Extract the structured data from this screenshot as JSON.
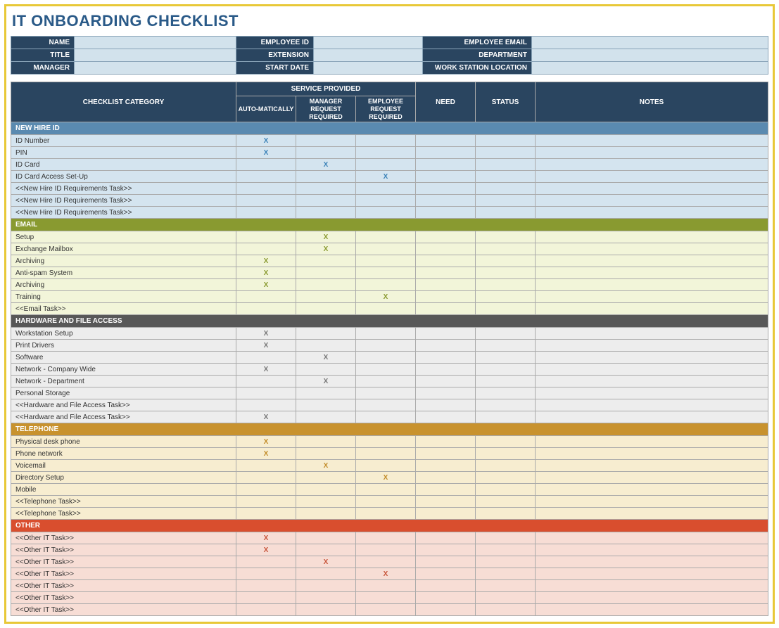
{
  "title": "IT ONBOARDING CHECKLIST",
  "info": {
    "name_label": "NAME",
    "name": "",
    "empid_label": "EMPLOYEE ID",
    "empid": "",
    "email_label": "EMPLOYEE EMAIL",
    "email": "",
    "title_label": "TITLE",
    "title_v": "",
    "ext_label": "EXTENSION",
    "ext": "",
    "dept_label": "DEPARTMENT",
    "dept": "",
    "mgr_label": "MANAGER",
    "mgr": "",
    "start_label": "START DATE",
    "start": "",
    "loc_label": "WORK STATION LOCATION",
    "loc": ""
  },
  "headers": {
    "category": "CHECKLIST CATEGORY",
    "service": "SERVICE PROVIDED",
    "auto": "AUTO-MATICALLY",
    "mgr_req": "MANAGER REQUEST REQUIRED",
    "emp_req": "EMPLOYEE REQUEST REQUIRED",
    "need": "NEED",
    "status": "STATUS",
    "notes": "NOTES"
  },
  "sections": [
    {
      "name": "NEW HIRE ID",
      "class": "newhire",
      "rows": [
        {
          "label": "ID Number",
          "auto": "X",
          "mgr": "",
          "emp": ""
        },
        {
          "label": "PIN",
          "auto": "X",
          "mgr": "",
          "emp": ""
        },
        {
          "label": "ID Card",
          "auto": "",
          "mgr": "X",
          "emp": ""
        },
        {
          "label": "ID Card Access Set-Up",
          "auto": "",
          "mgr": "",
          "emp": "X"
        },
        {
          "label": "<<New Hire ID Requirements Task>>",
          "auto": "",
          "mgr": "",
          "emp": ""
        },
        {
          "label": "<<New Hire ID Requirements Task>>",
          "auto": "",
          "mgr": "",
          "emp": ""
        },
        {
          "label": "<<New Hire ID Requirements Task>>",
          "auto": "",
          "mgr": "",
          "emp": ""
        }
      ]
    },
    {
      "name": "EMAIL",
      "class": "email",
      "rows": [
        {
          "label": "Setup",
          "auto": "",
          "mgr": "X",
          "emp": ""
        },
        {
          "label": "Exchange Mailbox",
          "auto": "",
          "mgr": "X",
          "emp": ""
        },
        {
          "label": "Archiving",
          "auto": "X",
          "mgr": "",
          "emp": ""
        },
        {
          "label": "Anti-spam System",
          "auto": "X",
          "mgr": "",
          "emp": ""
        },
        {
          "label": "Archiving",
          "auto": "X",
          "mgr": "",
          "emp": ""
        },
        {
          "label": "Training",
          "auto": "",
          "mgr": "",
          "emp": "X"
        },
        {
          "label": "<<Email Task>>",
          "auto": "",
          "mgr": "",
          "emp": ""
        }
      ]
    },
    {
      "name": "HARDWARE AND FILE ACCESS",
      "class": "hardware",
      "rows": [
        {
          "label": "Workstation Setup",
          "auto": "X",
          "mgr": "",
          "emp": ""
        },
        {
          "label": "Print Drivers",
          "auto": "X",
          "mgr": "",
          "emp": ""
        },
        {
          "label": "Software",
          "auto": "",
          "mgr": "X",
          "emp": ""
        },
        {
          "label": "Network - Company Wide",
          "auto": "X",
          "mgr": "",
          "emp": ""
        },
        {
          "label": "Network - Department",
          "auto": "",
          "mgr": "X",
          "emp": ""
        },
        {
          "label": "Personal Storage",
          "auto": "",
          "mgr": "",
          "emp": ""
        },
        {
          "label": "<<Hardware and File Access Task>>",
          "auto": "",
          "mgr": "",
          "emp": ""
        },
        {
          "label": "<<Hardware and File Access Task>>",
          "auto": "X",
          "mgr": "",
          "emp": ""
        }
      ]
    },
    {
      "name": "TELEPHONE",
      "class": "telephone",
      "rows": [
        {
          "label": "Physical desk phone",
          "auto": "X",
          "mgr": "",
          "emp": ""
        },
        {
          "label": "Phone network",
          "auto": "X",
          "mgr": "",
          "emp": ""
        },
        {
          "label": "Voicemail",
          "auto": "",
          "mgr": "X",
          "emp": ""
        },
        {
          "label": "Directory Setup",
          "auto": "",
          "mgr": "",
          "emp": "X"
        },
        {
          "label": "Mobile",
          "auto": "",
          "mgr": "",
          "emp": ""
        },
        {
          "label": "<<Telephone Task>>",
          "auto": "",
          "mgr": "",
          "emp": ""
        },
        {
          "label": "<<Telephone Task>>",
          "auto": "",
          "mgr": "",
          "emp": ""
        }
      ]
    },
    {
      "name": "OTHER",
      "class": "other",
      "rows": [
        {
          "label": "<<Other IT Task>>",
          "auto": "X",
          "mgr": "",
          "emp": ""
        },
        {
          "label": "<<Other IT Task>>",
          "auto": "X",
          "mgr": "",
          "emp": ""
        },
        {
          "label": "<<Other IT Task>>",
          "auto": "",
          "mgr": "X",
          "emp": ""
        },
        {
          "label": "<<Other IT Task>>",
          "auto": "",
          "mgr": "",
          "emp": "X"
        },
        {
          "label": "<<Other IT Task>>",
          "auto": "",
          "mgr": "",
          "emp": ""
        },
        {
          "label": "<<Other IT Task>>",
          "auto": "",
          "mgr": "",
          "emp": ""
        },
        {
          "label": "<<Other IT Task>>",
          "auto": "",
          "mgr": "",
          "emp": ""
        }
      ]
    }
  ]
}
